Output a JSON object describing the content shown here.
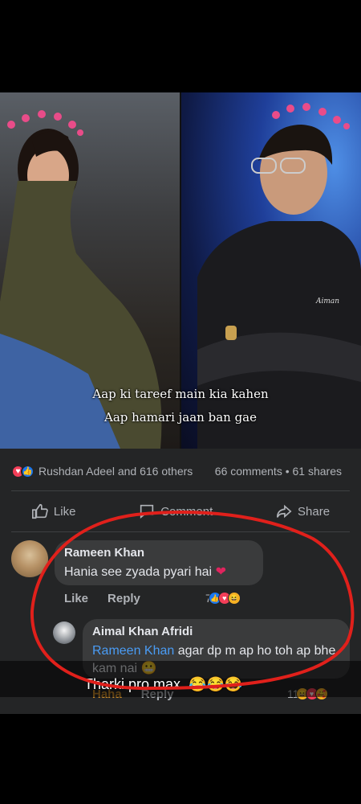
{
  "post": {
    "caption_line1": "Aap ki tareef main kia kahen",
    "caption_line2": "Aap hamari jaan ban gae",
    "watermark": "Aiman"
  },
  "reactions": {
    "summary": "Rushdan Adeel and 616 others",
    "comments": "66 comments",
    "separator": "•",
    "shares": "61 shares"
  },
  "actions": {
    "like": "Like",
    "comment": "Comment",
    "share": "Share"
  },
  "comments": [
    {
      "author": "Rameen Khan",
      "text": "Hania see zyada pyari hai",
      "emoji": "❤",
      "like_label": "Like",
      "reply_label": "Reply",
      "reaction_count": "7"
    },
    {
      "author": "Aimal Khan Afridi",
      "mention": "Rameen Khan",
      "text": " agar dp m ap ho toh ap bhe kam nai",
      "emoji": "😬",
      "like_label": "Haha",
      "reply_label": "Reply",
      "reaction_count": "11"
    }
  ],
  "overlay": {
    "text": "Tharki pro max..😂😂😂"
  },
  "colors": {
    "highlight": "#e0201b",
    "card_bg": "#242526",
    "bubble_bg": "#3a3b3c",
    "link": "#4a9cf5"
  }
}
